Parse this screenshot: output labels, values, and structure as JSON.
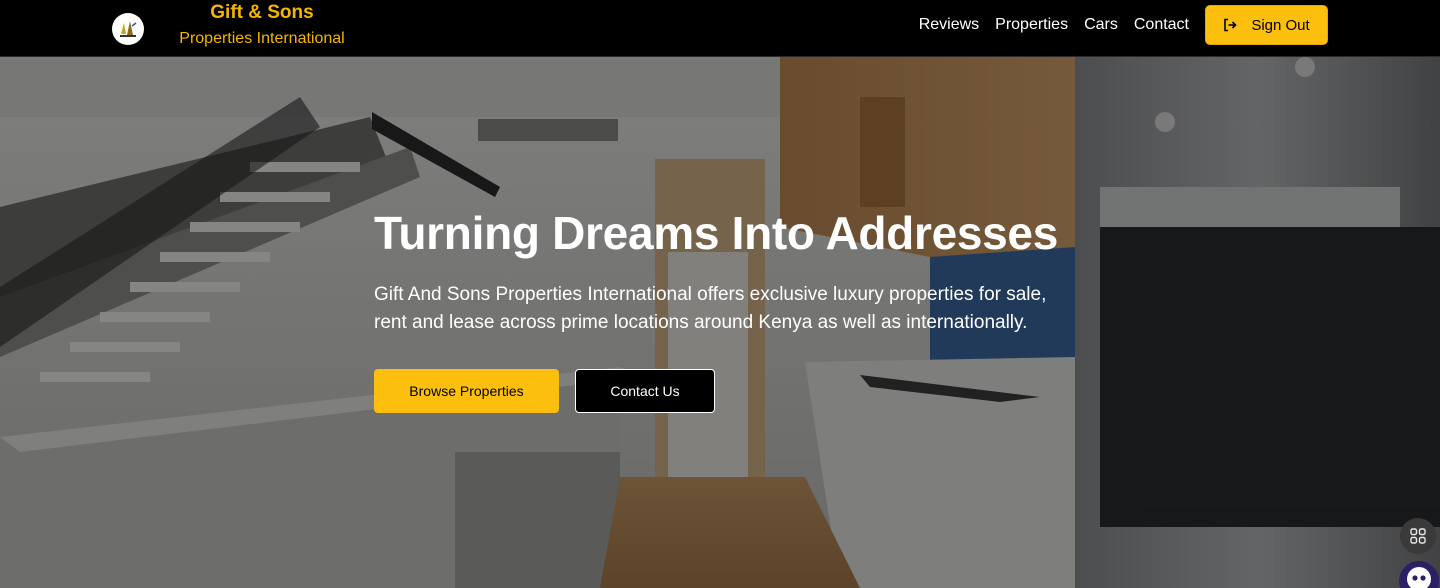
{
  "brand": {
    "name": "Gift & Sons",
    "subtitle": "Properties International",
    "accent_color": "#f7b500",
    "logo_icon": "company-logo-icon"
  },
  "nav": {
    "links": [
      "Reviews",
      "Properties",
      "Cars",
      "Contact"
    ],
    "signout_label": "Sign Out",
    "signout_icon": "sign-out-icon",
    "button_color": "#fcbf0d"
  },
  "hero": {
    "title": "Turning Dreams Into Addresses",
    "description": "Gift And Sons Properties International offers exclusive luxury properties for sale, rent and lease across prime locations around Kenya as well as internationally.",
    "primary_button": "Browse Properties",
    "secondary_button": "Contact Us",
    "background": "kitchen-interior-photo"
  },
  "floating": {
    "grid_icon": "grid-apps-icon",
    "bot_icon": "chat-bot-icon"
  }
}
